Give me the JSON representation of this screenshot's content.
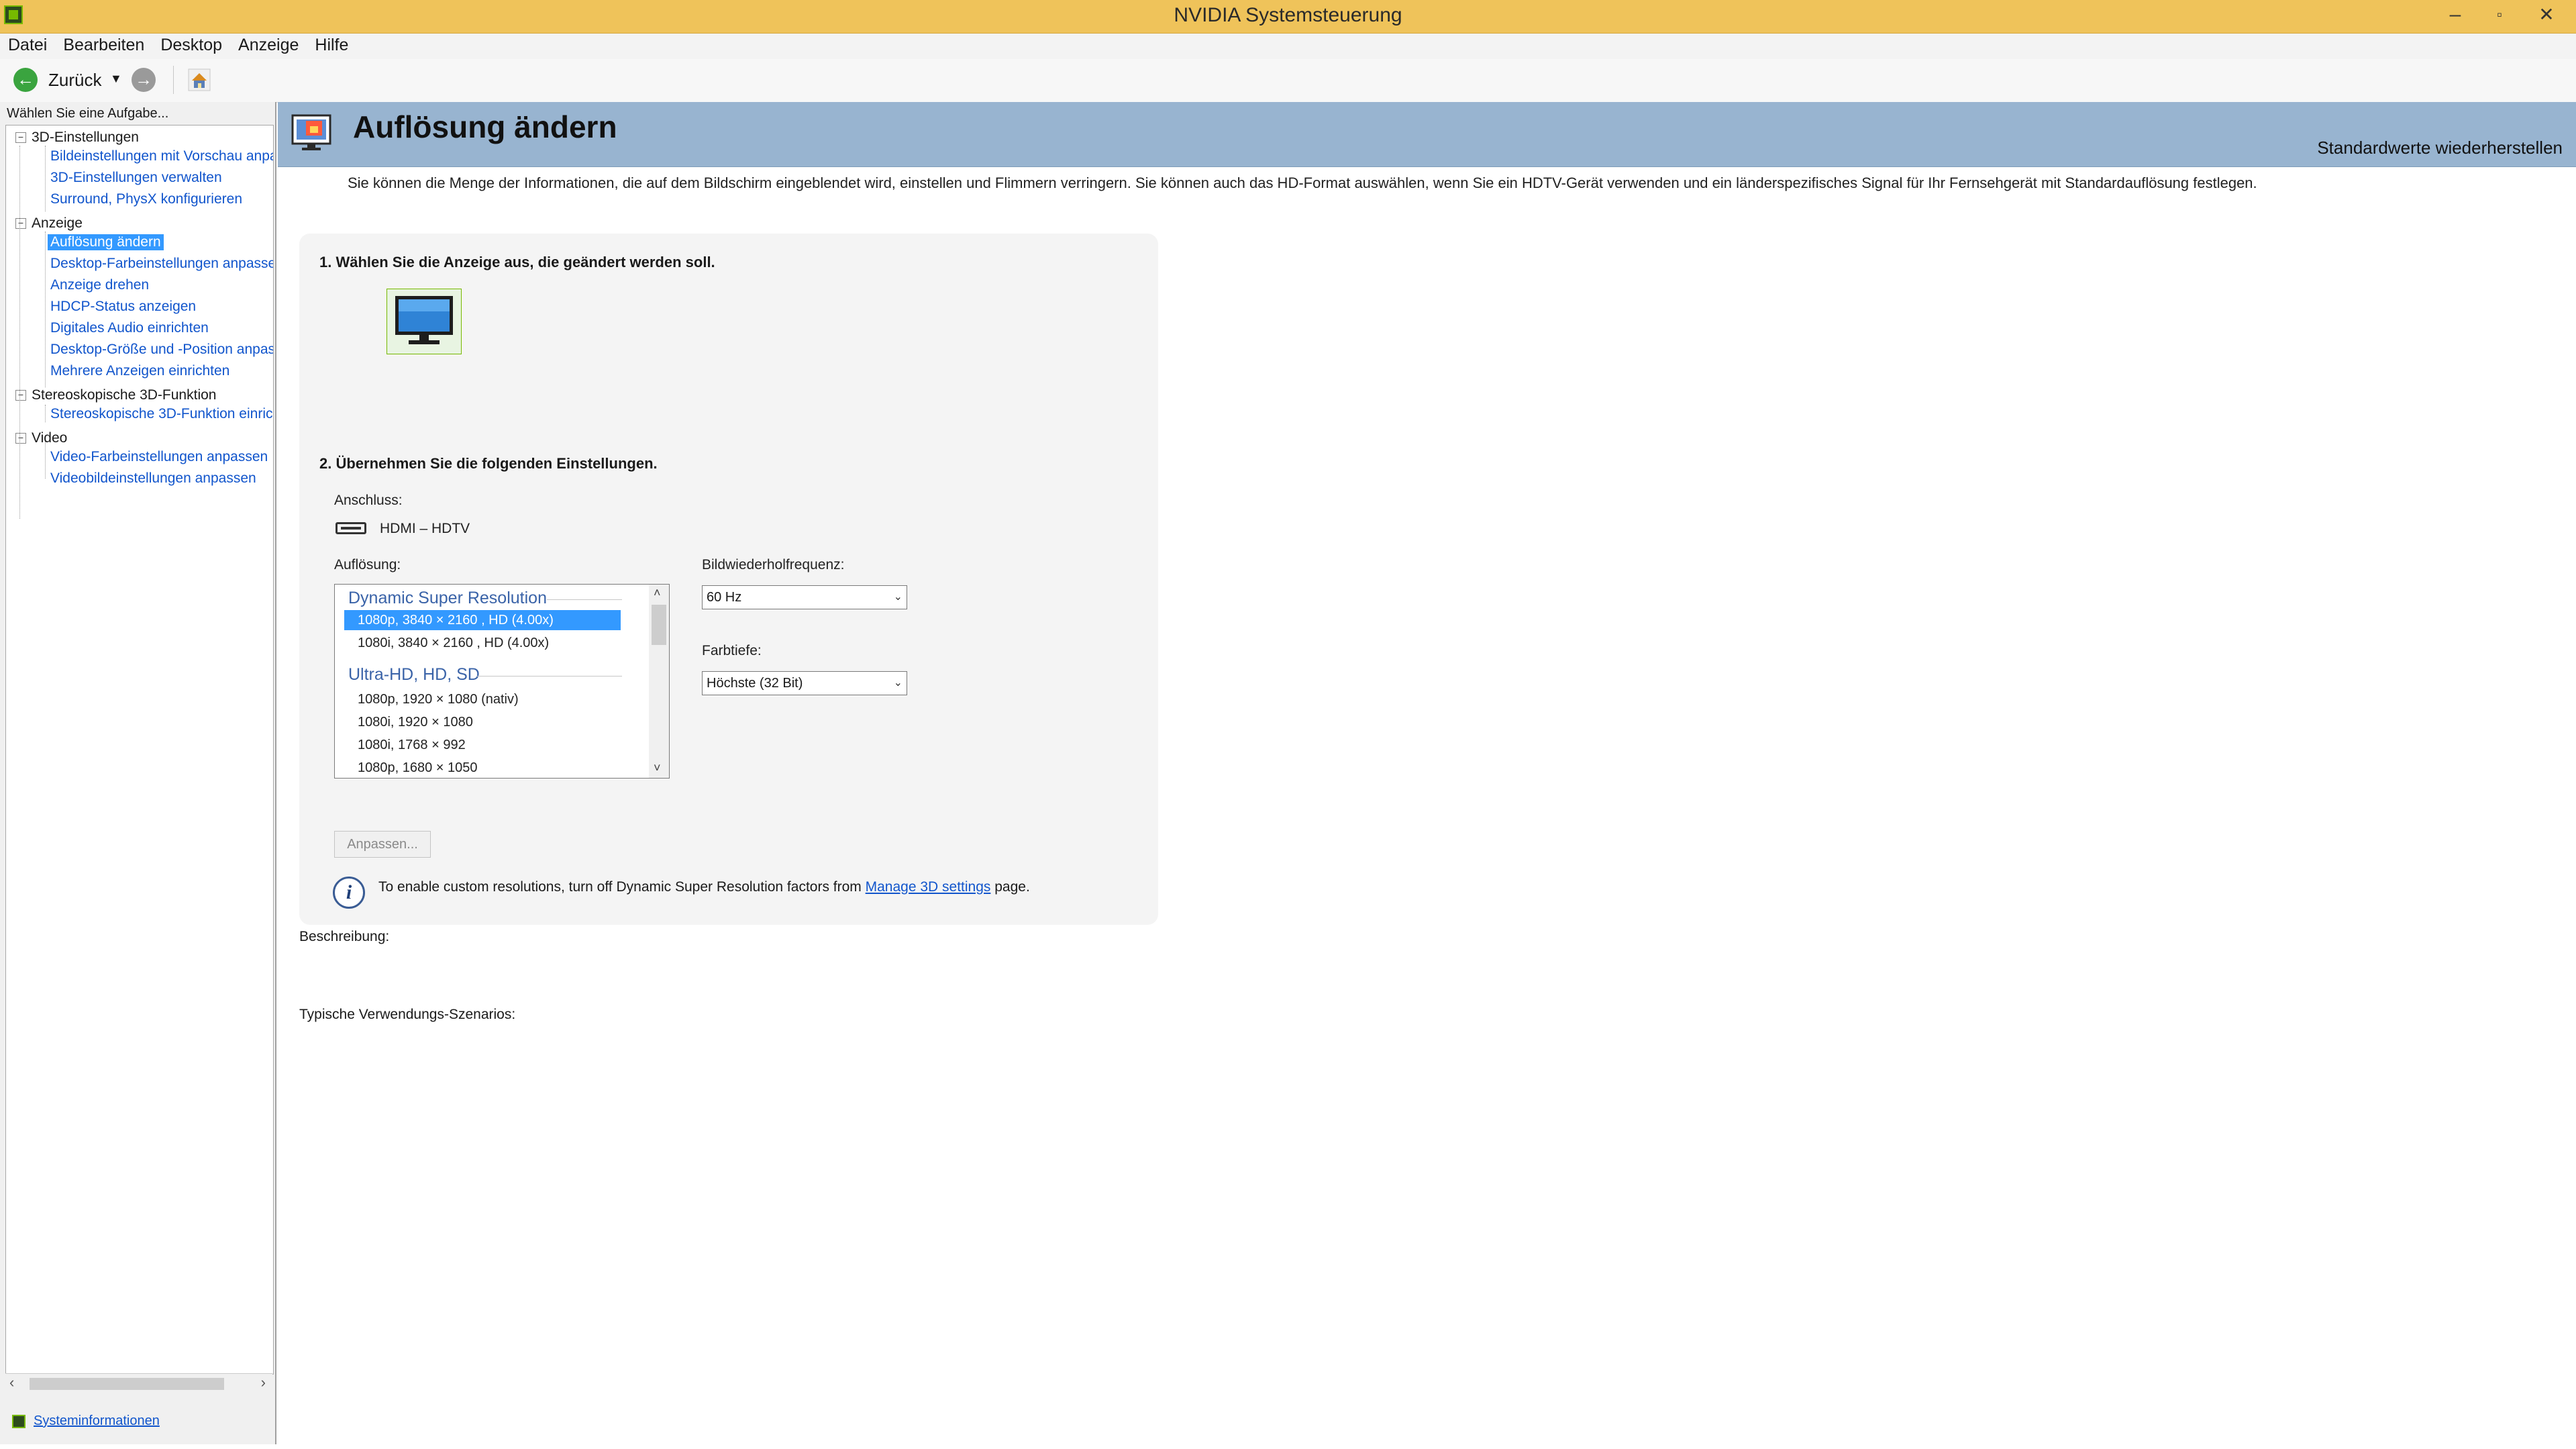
{
  "window": {
    "title": "NVIDIA Systemsteuerung",
    "minimize": "–",
    "maximize": "▫",
    "close": "✕"
  },
  "menu": [
    "Datei",
    "Bearbeiten",
    "Desktop",
    "Anzeige",
    "Hilfe"
  ],
  "toolbar": {
    "back_label": "Zurück",
    "back_icon": "back-arrow-icon",
    "forward_icon": "forward-arrow-icon",
    "home_icon": "home-icon"
  },
  "sidebar": {
    "task_label": "Wählen Sie eine Aufgabe...",
    "categories": [
      {
        "label": "3D-Einstellungen",
        "items": [
          "Bildeinstellungen mit Vorschau anpa",
          "3D-Einstellungen verwalten",
          "Surround, PhysX konfigurieren"
        ]
      },
      {
        "label": "Anzeige",
        "items": [
          "Auflösung ändern",
          "Desktop-Farbeinstellungen anpassen",
          "Anzeige drehen",
          "HDCP-Status anzeigen",
          "Digitales Audio einrichten",
          "Desktop-Größe und -Position anpass",
          "Mehrere Anzeigen einrichten"
        ]
      },
      {
        "label": "Stereoskopische 3D-Funktion",
        "items": [
          "Stereoskopische 3D-Funktion einrich"
        ]
      },
      {
        "label": "Video",
        "items": [
          "Video-Farbeinstellungen anpassen",
          "Videobildeinstellungen anpassen"
        ]
      }
    ],
    "collapse_symbol": "−",
    "scroll_left": "‹",
    "scroll_right": "›",
    "system_info": "Systeminformationen"
  },
  "header": {
    "title": "Auflösung ändern",
    "restore_defaults": "Standardwerte wiederherstellen"
  },
  "intro": "Sie können die Menge der Informationen, die auf dem Bildschirm eingeblendet wird, einstellen und Flimmern verringern. Sie können auch das HD-Format auswählen, wenn Sie ein HDTV-Gerät verwenden und ein länderspezifisches Signal für Ihr Fernsehgerät mit Standardauflösung festlegen.",
  "step1": {
    "title": "1. Wählen Sie die Anzeige aus, die geändert werden soll."
  },
  "step2": {
    "title": "2. Übernehmen Sie die folgenden Einstellungen.",
    "connection_label": "Anschluss:",
    "connection_value": "HDMI – HDTV",
    "resolution_label": "Auflösung:",
    "resolution_groups": [
      {
        "name": "Dynamic Super Resolution",
        "items": [
          "1080p, 3840 × 2160 , HD (4.00x)",
          "1080i, 3840 × 2160 , HD (4.00x)"
        ]
      },
      {
        "name": "Ultra-HD, HD, SD",
        "items": [
          "1080p, 1920 × 1080 (nativ)",
          "1080i, 1920 × 1080",
          "1080i, 1768 × 992",
          "1080p, 1680 × 1050"
        ]
      }
    ],
    "scroll_up": "˄",
    "scroll_down": "˅",
    "refresh_label": "Bildwiederholfrequenz:",
    "refresh_value": "60 Hz",
    "color_depth_label": "Farbtiefe:",
    "color_depth_value": "Höchste (32 Bit)",
    "dropdown_caret": "⌄",
    "customize_button": "Anpassen...",
    "info_icon": "i",
    "info_text": "To enable custom resolutions, turn off Dynamic Super Resolution factors from ",
    "info_link": "Manage 3D settings",
    "info_suffix": " page."
  },
  "description_label": "Beschreibung:",
  "usage_label": "Typische Verwendungs-Szenarios:",
  "colors": {
    "titlebar": "#efc35a",
    "header": "#98b4d0",
    "accent": "#76b900",
    "selection": "#3399ff",
    "link": "#1155cc"
  }
}
